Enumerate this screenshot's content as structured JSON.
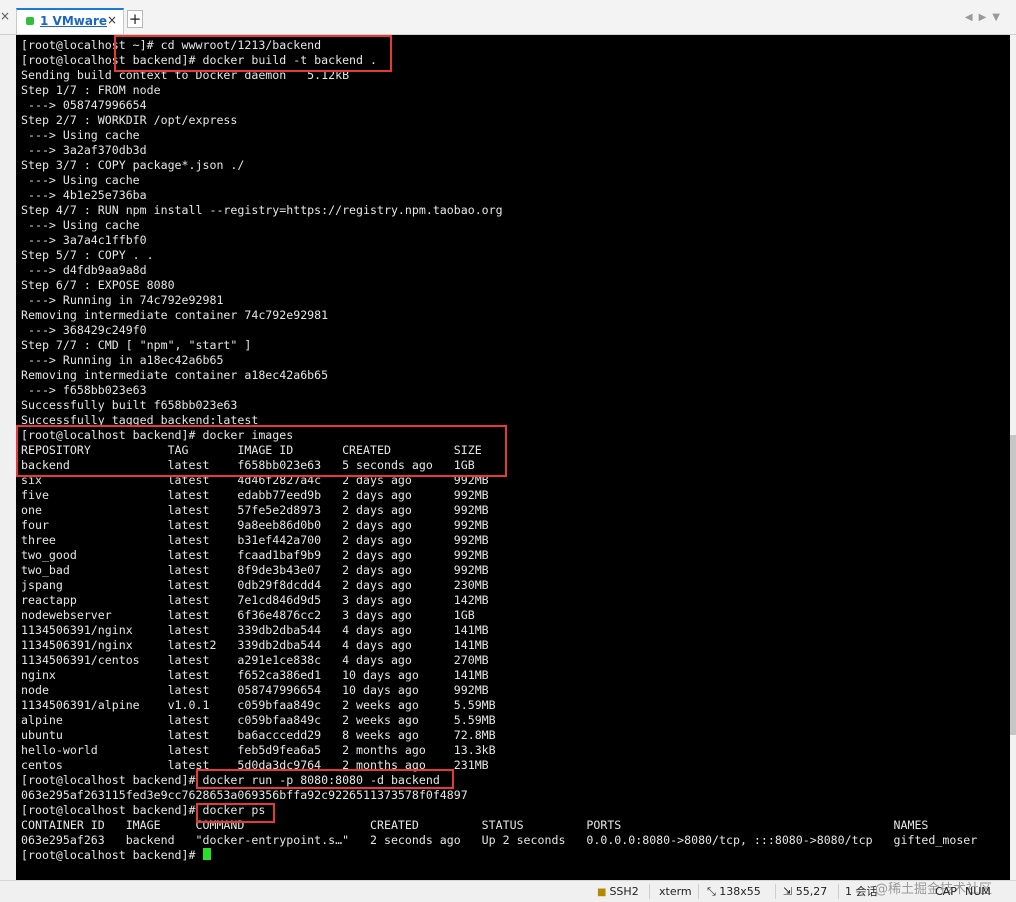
{
  "tab": {
    "label": "1 VMware",
    "close": "×"
  },
  "new_tab": "+",
  "terminal_lines": [
    "[root@localhost ~]# cd wwwroot/1213/backend",
    "[root@localhost backend]# docker build -t backend .",
    "Sending build context to Docker daemon   5.12kB",
    "Step 1/7 : FROM node",
    " ---> 058747996654",
    "Step 2/7 : WORKDIR /opt/express",
    " ---> Using cache",
    " ---> 3a2af370db3d",
    "Step 3/7 : COPY package*.json ./",
    " ---> Using cache",
    " ---> 4b1e25e736ba",
    "Step 4/7 : RUN npm install --registry=https://registry.npm.taobao.org",
    " ---> Using cache",
    " ---> 3a7a4c1ffbf0",
    "Step 5/7 : COPY . .",
    " ---> d4fdb9aa9a8d",
    "Step 6/7 : EXPOSE 8080",
    " ---> Running in 74c792e92981",
    "Removing intermediate container 74c792e92981",
    " ---> 368429c249f0",
    "Step 7/7 : CMD [ \"npm\", \"start\" ]",
    " ---> Running in a18ec42a6b65",
    "Removing intermediate container a18ec42a6b65",
    " ---> f658bb023e63",
    "Successfully built f658bb023e63",
    "Successfully tagged backend:latest",
    "[root@localhost backend]# docker images",
    "REPOSITORY           TAG       IMAGE ID       CREATED         SIZE",
    "backend              latest    f658bb023e63   5 seconds ago   1GB",
    "six                  latest    4d46f2827a4c   2 days ago      992MB",
    "five                 latest    edabb77eed9b   2 days ago      992MB",
    "one                  latest    57fe5e2d8973   2 days ago      992MB",
    "four                 latest    9a8eeb86d0b0   2 days ago      992MB",
    "three                latest    b31ef442a700   2 days ago      992MB",
    "two_good             latest    fcaad1baf9b9   2 days ago      992MB",
    "two_bad              latest    8f9de3b43e07   2 days ago      992MB",
    "jspang               latest    0db29f8dcdd4   2 days ago      230MB",
    "reactapp             latest    7e1cd846d9d5   3 days ago      142MB",
    "nodewebserver        latest    6f36e4876cc2   3 days ago      1GB",
    "1134506391/nginx     latest    339db2dba544   4 days ago      141MB",
    "1134506391/nginx     latest2   339db2dba544   4 days ago      141MB",
    "1134506391/centos    latest    a291e1ce838c   4 days ago      270MB",
    "nginx                latest    f652ca386ed1   10 days ago     141MB",
    "node                 latest    058747996654   10 days ago     992MB",
    "1134506391/alpine    v1.0.1    c059bfaa849c   2 weeks ago     5.59MB",
    "alpine               latest    c059bfaa849c   2 weeks ago     5.59MB",
    "ubuntu               latest    ba6acccedd29   8 weeks ago     72.8MB",
    "hello-world          latest    feb5d9fea6a5   2 months ago    13.3kB",
    "centos               latest    5d0da3dc9764   2 months ago    231MB",
    "[root@localhost backend]# docker run -p 8080:8080 -d backend",
    "063e295af263115fed3e9cc7628653a069356bffa92c9226511373578f0f4897",
    "[root@localhost backend]# docker ps",
    "CONTAINER ID   IMAGE     COMMAND                  CREATED         STATUS         PORTS                                       NAMES",
    "063e295af263   backend   \"docker-entrypoint.s…\"   2 seconds ago   Up 2 seconds   0.0.0.0:8080->8080/tcp, :::8080->8080/tcp   gifted_moser",
    "[root@localhost backend]# "
  ],
  "status_bar": {
    "protocol": "SSH2",
    "terminal_type": "xterm",
    "size": "138x55",
    "cursor_pos": "55,27",
    "sessions": "1 会话",
    "watermark": "@稀土掘金技术社区",
    "cap": "CAP",
    "num": "NUM"
  },
  "icons": {
    "nav_left": "chevron-left-icon",
    "nav_right": "chevron-right-icon",
    "menu": "chevron-down-icon",
    "lock": "lock-icon",
    "size": "resize-icon",
    "cursor": "cursor-position-icon"
  },
  "colors": {
    "terminal_bg": "#000000",
    "terminal_fg": "#e6e6e6",
    "cursor": "#28e028",
    "highlight": "#e53935",
    "tab_accent": "#1a7bd6",
    "tab_status": "#2fbf3a"
  }
}
